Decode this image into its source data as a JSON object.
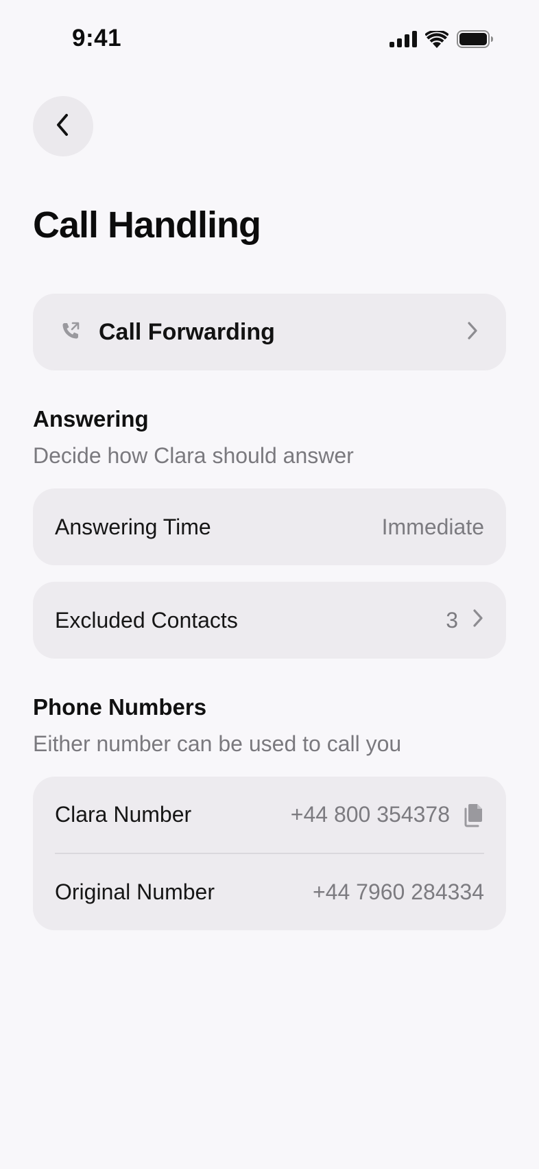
{
  "status_bar": {
    "time": "9:41",
    "icons": [
      "cellular-signal-icon",
      "wifi-icon",
      "battery-icon"
    ]
  },
  "nav": {
    "back_icon": "chevron-left-icon"
  },
  "page": {
    "title": "Call Handling"
  },
  "call_forwarding": {
    "icon": "phone-forward-icon",
    "label": "Call Forwarding",
    "chevron": "chevron-right-icon"
  },
  "answering": {
    "heading": "Answering",
    "subtitle": "Decide how Clara should answer",
    "answering_time": {
      "label": "Answering Time",
      "value": "Immediate"
    },
    "excluded_contacts": {
      "label": "Excluded Contacts",
      "count": "3"
    }
  },
  "phone_numbers": {
    "heading": "Phone Numbers",
    "subtitle": "Either number can be used to call you",
    "clara_number": {
      "label": "Clara Number",
      "value": "+44 800 354378",
      "icon": "copy-icon"
    },
    "original_number": {
      "label": "Original Number",
      "value": "+44 7960 284334"
    }
  },
  "colors": {
    "background": "#f8f7fa",
    "card": "#edebef",
    "secondary_text": "#7c7b80",
    "primary_text": "#111111"
  }
}
